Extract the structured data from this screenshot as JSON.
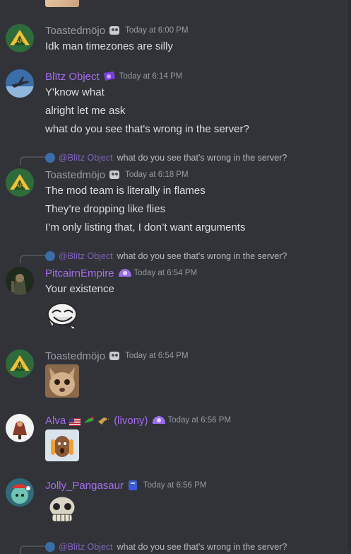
{
  "messages": [
    {
      "author": "Toastedmöjo",
      "author_color": "#949ba4",
      "timestamp": "Today at 6:00 PM",
      "lines": [
        "Idk man timezones are silly"
      ]
    },
    {
      "author": "Blïtz Object",
      "author_color": "#a66cf0",
      "timestamp": "Today at 6:14 PM",
      "lines": [
        "Y'know what",
        "alright let me ask",
        "what do you see that's wrong in the server?"
      ]
    },
    {
      "reply_to": {
        "author": "@Blïtz Object",
        "text": "what do you see that's wrong in the server?"
      },
      "author": "Toastedmöjo",
      "author_color": "#949ba4",
      "timestamp": "Today at 6:18 PM",
      "lines": [
        "The mod team is literally in flames",
        "They’re dropping like flies",
        "I’m only listing that, I don’t want arguments"
      ]
    },
    {
      "reply_to": {
        "author": "@Blïtz Object",
        "text": "what do you see that's wrong in the server?"
      },
      "author": "PitcairnEmpire",
      "author_color": "#a66cf0",
      "timestamp": "Today at 6:54 PM",
      "lines": [
        "Your existence"
      ],
      "attachment": "trollface-emoji"
    },
    {
      "author": "Toastedmöjo",
      "author_color": "#949ba4",
      "timestamp": "Today at 6:54 PM",
      "attachment": "cat-image"
    },
    {
      "author": "Alva",
      "author_suffix": "(livony)",
      "author_color": "#a66cf0",
      "timestamp": "Today at 6:56 PM",
      "attachment": "shocked-man-image"
    },
    {
      "author": "Jolly_Pangasaur",
      "author_color": "#a66cf0",
      "timestamp": "Today at 6:56 PM",
      "attachment": "skull-emoji"
    },
    {
      "reply_to": {
        "author": "@Blïtz Object",
        "text": "what do you see that's wrong in the server?"
      }
    }
  ],
  "colors": {
    "background": "#313338",
    "text": "#dbdee1",
    "timestamp": "#949ba4",
    "role_purple": "#a66cf0"
  }
}
